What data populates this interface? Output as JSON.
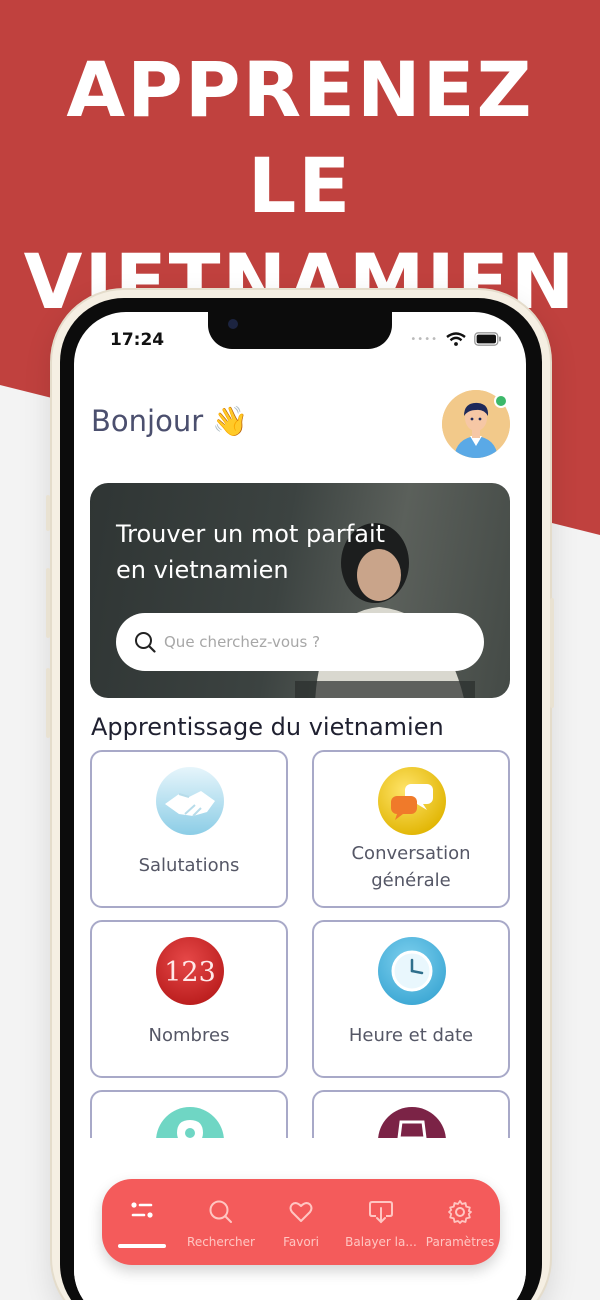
{
  "promo": {
    "headline_line1": "APPRENEZ LE",
    "headline_line2": "VIETNAMIEN",
    "colors": {
      "red": "#c0413e",
      "light": "#f3f3f3"
    }
  },
  "status_bar": {
    "time": "17:24"
  },
  "header": {
    "greeting": "Bonjour 👋",
    "avatar": "user-avatar"
  },
  "hero": {
    "title": "Trouver un mot parfait en vietnamien",
    "search_placeholder": "Que cherchez-vous ?"
  },
  "section": {
    "title": "Apprentissage du vietnamien"
  },
  "categories": [
    {
      "label": "Salutations",
      "icon": "handshake-icon"
    },
    {
      "label": "Conversation générale",
      "icon": "chat-bubbles-icon"
    },
    {
      "label": "Nombres",
      "icon": "numbers-123-icon"
    },
    {
      "label": "Heure et date",
      "icon": "clock-icon"
    },
    {
      "label": "",
      "icon": "location-pin-icon"
    },
    {
      "label": "",
      "icon": "shopping-bag-icon"
    }
  ],
  "tabbar": {
    "accent": "#f45b5b",
    "tabs": [
      {
        "label": "",
        "icon": "home-list-icon",
        "active": true
      },
      {
        "label": "Rechercher",
        "icon": "search-icon",
        "active": false
      },
      {
        "label": "Favori",
        "icon": "heart-icon",
        "active": false
      },
      {
        "label": "Balayer la...",
        "icon": "swipe-download-icon",
        "active": false
      },
      {
        "label": "Paramètres",
        "icon": "gear-icon",
        "active": false
      }
    ]
  }
}
